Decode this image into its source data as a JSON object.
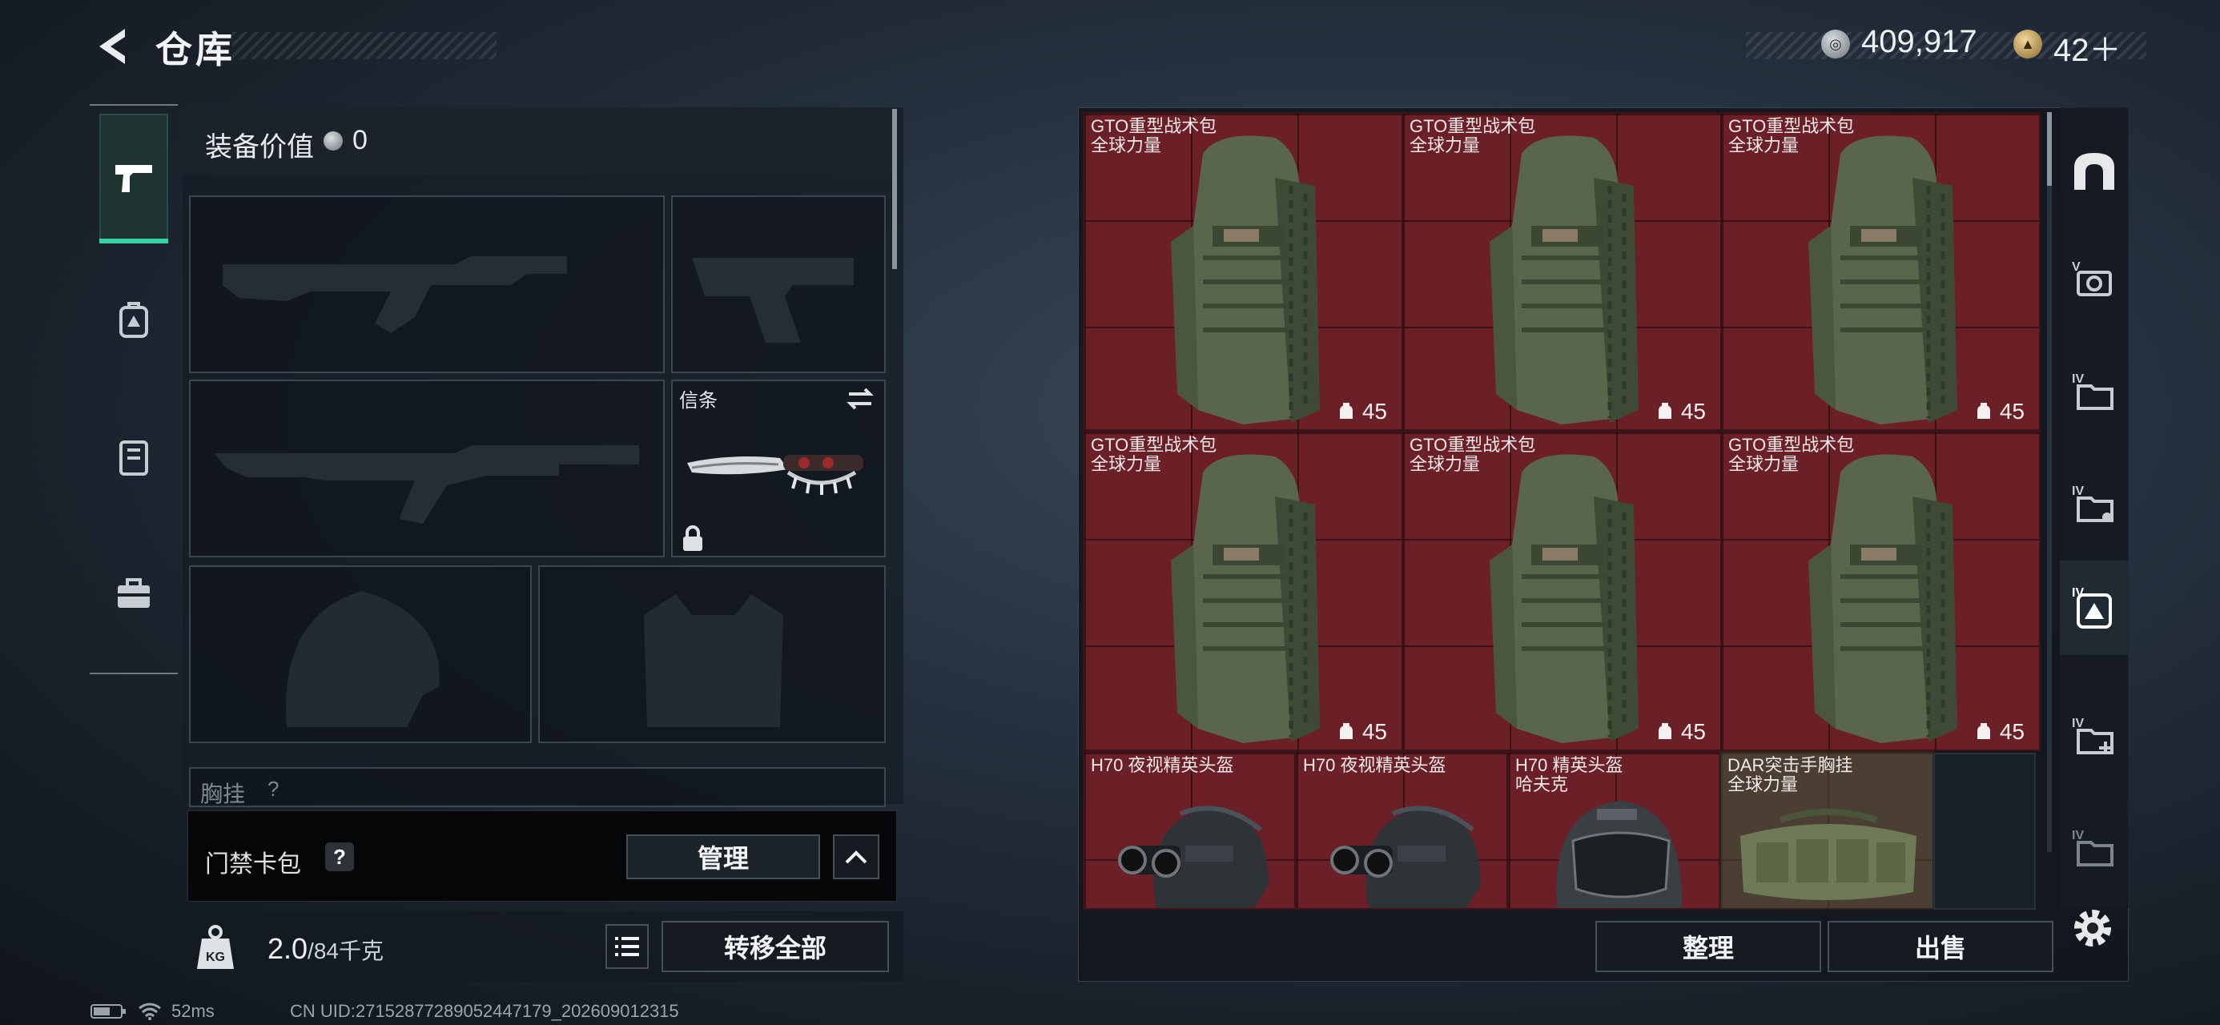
{
  "header": {
    "title": "仓库",
    "currency": [
      {
        "icon": "silver-coin-icon",
        "value": "409,917"
      },
      {
        "icon": "gold-coin-icon",
        "value": "42＋"
      }
    ]
  },
  "equipment": {
    "label": "装备价值",
    "value": "0",
    "melee_label": "信条",
    "chest_label": "胸挂",
    "chest_help": "?"
  },
  "keycard": {
    "label": "门禁卡包",
    "help": "?",
    "manage": "管理"
  },
  "bottom": {
    "weight": "2.0",
    "weight_max": "/84千克",
    "transfer": "转移全部"
  },
  "status": {
    "ping": "52ms",
    "uid": "CN UID:2715287728905244717​9_202609012315"
  },
  "storage": {
    "items": [
      {
        "line1": "GTO重型战术包",
        "line2": "全球力量",
        "capacity": "45"
      },
      {
        "line1": "GTO重型战术包",
        "line2": "全球力量",
        "capacity": "45"
      },
      {
        "line1": "GTO重型战术包",
        "line2": "全球力量",
        "capacity": "45"
      },
      {
        "line1": "GTO重型战术包",
        "line2": "全球力量",
        "capacity": "45"
      },
      {
        "line1": "GTO重型战术包",
        "line2": "全球力量",
        "capacity": "45"
      },
      {
        "line1": "GTO重型战术包",
        "line2": "全球力量",
        "capacity": "45"
      },
      {
        "line1": "H70 夜视精英头盔",
        "line2": ""
      },
      {
        "line1": "H70 夜视精英头盔",
        "line2": ""
      },
      {
        "line1": "H70 精英头盔",
        "line2": "哈夫克"
      },
      {
        "line1": "DAR突击手胸挂",
        "line2": "全球力量"
      }
    ],
    "sort": "整理",
    "sell": "出售"
  },
  "colors": {
    "accent": "#36d3a4",
    "item_bg": "#6b1f27"
  }
}
